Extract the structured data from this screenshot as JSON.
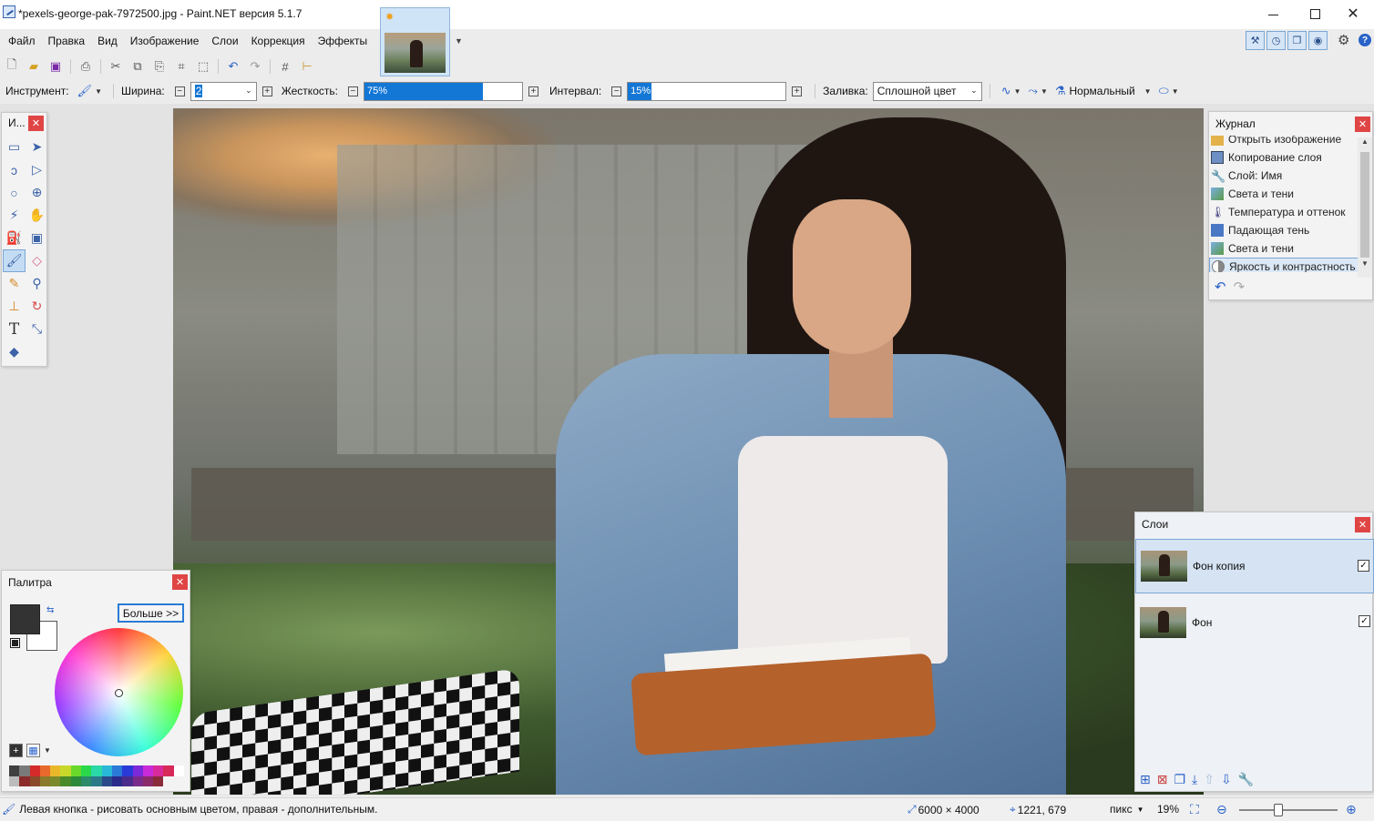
{
  "window": {
    "title": "*pexels-george-pak-7972500.jpg - Paint.NET версия 5.1.7",
    "min": "—",
    "close": "✕"
  },
  "menu": [
    "Файл",
    "Правка",
    "Вид",
    "Изображение",
    "Слои",
    "Коррекция",
    "Эффекты"
  ],
  "tool_options": {
    "tool_label": "Инструмент:",
    "width_label": "Ширина:",
    "width_value": "2",
    "hardness_label": "Жесткость:",
    "hardness_value": "75%",
    "hardness_fraction": 0.75,
    "spacing_label": "Интервал:",
    "spacing_value": "15%",
    "spacing_fraction": 0.15,
    "fill_label": "Заливка:",
    "fill_value": "Сплошной цвет",
    "blend_value": "Нормальный"
  },
  "tools_panel": {
    "title": "И..."
  },
  "history": {
    "title": "Журнал",
    "items": [
      "Открыть изображение",
      "Копирование слоя",
      "Слой: Имя",
      "Света и тени",
      "Температура и оттенок",
      "Падающая тень",
      "Света и тени",
      "Яркость и контрастность"
    ],
    "selected_index": 7
  },
  "palette": {
    "title": "Палитра",
    "more_button": "Больше >>",
    "primary_color": "#333333",
    "secondary_color": "#ffffff",
    "strip_colors": [
      "#404040",
      "#7a7a7a",
      "#d42a2a",
      "#e86a2a",
      "#e8b82a",
      "#c8d82a",
      "#6ad82a",
      "#2ad84a",
      "#2ad8a8",
      "#2ab8d8",
      "#2a7ad8",
      "#2a3ad8",
      "#7a2ad8",
      "#c82ad8",
      "#d82a9a",
      "#d82a5a",
      "#ffffff",
      "#bcbcbc",
      "#8a2a2a",
      "#8a4a2a",
      "#8a7a2a",
      "#7a8a2a",
      "#4a8a2a",
      "#2a8a3a",
      "#2a8a6a",
      "#2a7a8a",
      "#2a4a8a",
      "#2a2a8a",
      "#4a2a8a",
      "#7a2a8a",
      "#8a2a6a",
      "#8a2a3a"
    ]
  },
  "layers": {
    "title": "Слои",
    "items": [
      {
        "name": "Фон копия",
        "visible": true,
        "selected": true
      },
      {
        "name": "Фон",
        "visible": true,
        "selected": false
      }
    ]
  },
  "status": {
    "hint": "Левая кнопка - рисовать основным цветом, правая - дополнительным.",
    "image_size": "6000 × 4000",
    "cursor_pos": "1221, 679",
    "units": "пикс",
    "zoom": "19%"
  }
}
